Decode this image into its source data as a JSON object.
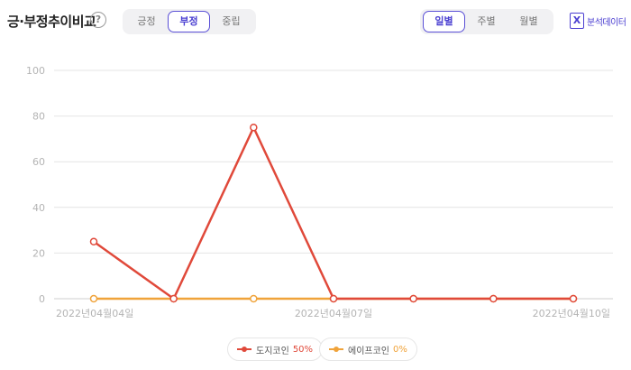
{
  "header": {
    "title": "긍·부정추이비교",
    "help_icon": "?",
    "sentiment_tabs": [
      "긍정",
      "부정",
      "중립"
    ],
    "sentiment_active": "부정",
    "period_tabs": [
      "일별",
      "주별",
      "월별"
    ],
    "period_active": "일별",
    "export_label": "분석데이터",
    "export_icon_glyph": "X"
  },
  "legend": [
    {
      "name": "도지코인",
      "pct": "50%",
      "color": "#e0493a"
    },
    {
      "name": "에이프코인",
      "pct": "0%",
      "color": "#f0a33a"
    }
  ],
  "chart_data": {
    "type": "line",
    "y_ticks": [
      "100",
      "80",
      "60",
      "40",
      "20",
      "0"
    ],
    "ylim": [
      0,
      100
    ],
    "x_tick_labels": [
      "2022년04월04일",
      "2022년04월07일",
      "2022년04월10일"
    ],
    "x_points": 7,
    "grid": true,
    "series": [
      {
        "name": "도지코인",
        "color": "#e0493a",
        "values": [
          25,
          0,
          75,
          0,
          0,
          0,
          0
        ]
      },
      {
        "name": "에이프코인",
        "color": "#f0a33a",
        "values": [
          0,
          0,
          0,
          0,
          0,
          0,
          0
        ]
      }
    ]
  }
}
